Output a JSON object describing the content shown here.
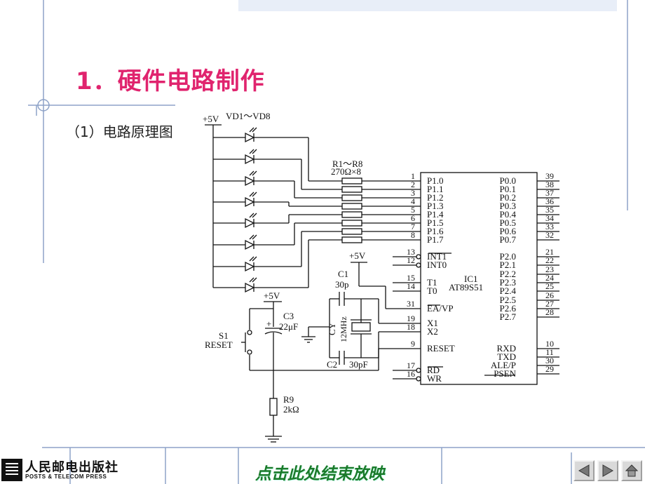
{
  "slide": {
    "title": "1．硬件电路制作",
    "subtitle": "（1）电路原理图",
    "end_show": "点击此处结束放映",
    "logo_cn": "人民邮电出版社",
    "logo_en": "POSTS & TELECOM PRESS",
    "title_color": "#e0246e",
    "nav_icons": [
      "prev-arrow-icon",
      "next-arrow-icon",
      "home-icon"
    ]
  },
  "schematic": {
    "vcc_top": "+5V",
    "leds_label": "VD1～VD8",
    "res_label": "R1～R8",
    "res_value": "270Ω×8",
    "chip_name": "IC1",
    "chip_model": "AT89S51",
    "left_pins": [
      {
        "num": "1",
        "name": "P1.0"
      },
      {
        "num": "2",
        "name": "P1.1"
      },
      {
        "num": "3",
        "name": "P1.2"
      },
      {
        "num": "4",
        "name": "P1.3"
      },
      {
        "num": "5",
        "name": "P1.4"
      },
      {
        "num": "6",
        "name": "P1.5"
      },
      {
        "num": "7",
        "name": "P1.6"
      },
      {
        "num": "8",
        "name": "P1.7"
      },
      {
        "num": "13",
        "name": "INT1"
      },
      {
        "num": "12",
        "name": "INT0"
      },
      {
        "num": "15",
        "name": "T1"
      },
      {
        "num": "14",
        "name": "T0"
      },
      {
        "num": "31",
        "name": "EA/VP"
      },
      {
        "num": "19",
        "name": "X1"
      },
      {
        "num": "18",
        "name": "X2"
      },
      {
        "num": "9",
        "name": "RESET"
      },
      {
        "num": "17",
        "name": "RD"
      },
      {
        "num": "16",
        "name": "WR"
      }
    ],
    "right_pins": [
      {
        "num": "39",
        "name": "P0.0"
      },
      {
        "num": "38",
        "name": "P0.1"
      },
      {
        "num": "37",
        "name": "P0.2"
      },
      {
        "num": "36",
        "name": "P0.3"
      },
      {
        "num": "35",
        "name": "P0.4"
      },
      {
        "num": "34",
        "name": "P0.5"
      },
      {
        "num": "33",
        "name": "P0.6"
      },
      {
        "num": "32",
        "name": "P0.7"
      },
      {
        "num": "21",
        "name": "P2.0"
      },
      {
        "num": "22",
        "name": "P2.1"
      },
      {
        "num": "23",
        "name": "P2.2"
      },
      {
        "num": "24",
        "name": "P2.3"
      },
      {
        "num": "25",
        "name": "P2.4"
      },
      {
        "num": "26",
        "name": "P2.5"
      },
      {
        "num": "27",
        "name": "P2.6"
      },
      {
        "num": "28",
        "name": "P2.7"
      },
      {
        "num": "10",
        "name": "RXD"
      },
      {
        "num": "11",
        "name": "TXD"
      },
      {
        "num": "30",
        "name": "ALE/P"
      },
      {
        "num": "29",
        "name": "PSEN"
      }
    ],
    "vcc_ea": "+5V",
    "c1_label": "C1",
    "c1_value": "30p",
    "cy_label": "CY",
    "cy_value": "12MHz",
    "c2_label": "C2",
    "c2_value": "30pF",
    "vcc_reset": "+5V",
    "c3_label": "C3",
    "c3_value": "22μF",
    "c3_plus": "+",
    "s1_label": "S1",
    "s1_name": "RESET",
    "r9_label": "R9",
    "r9_value": "2kΩ"
  }
}
